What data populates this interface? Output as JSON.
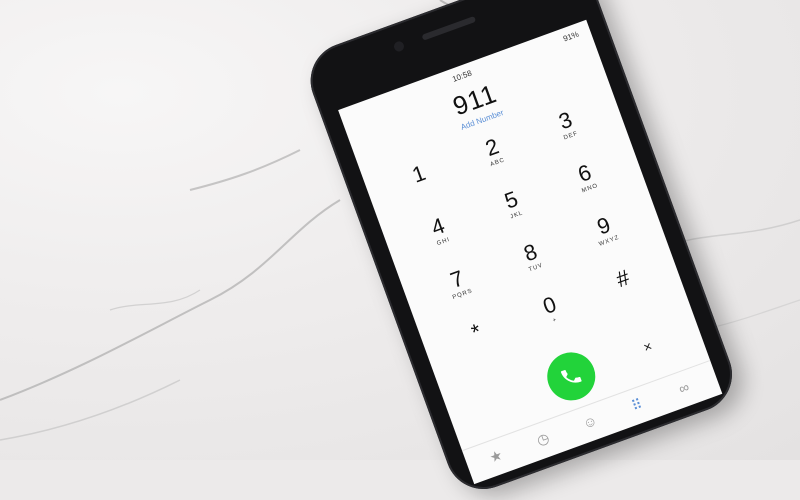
{
  "status_bar": {
    "time": "10:58",
    "battery": "91%"
  },
  "dialer": {
    "number": "911",
    "add_number_label": "Add Number"
  },
  "keypad": [
    {
      "digit": "1",
      "letters": ""
    },
    {
      "digit": "2",
      "letters": "ABC"
    },
    {
      "digit": "3",
      "letters": "DEF"
    },
    {
      "digit": "4",
      "letters": "GHI"
    },
    {
      "digit": "5",
      "letters": "JKL"
    },
    {
      "digit": "6",
      "letters": "MNO"
    },
    {
      "digit": "7",
      "letters": "PQRS"
    },
    {
      "digit": "8",
      "letters": "TUV"
    },
    {
      "digit": "9",
      "letters": "WXYZ"
    },
    {
      "digit": "*",
      "letters": ""
    },
    {
      "digit": "0",
      "letters": "+"
    },
    {
      "digit": "#",
      "letters": ""
    }
  ],
  "actions": {
    "delete_symbol": "×"
  },
  "tabbar": {
    "icons": [
      "favorites-icon",
      "recents-icon",
      "contacts-icon",
      "keypad-icon",
      "voicemail-icon"
    ]
  },
  "colors": {
    "call_button": "#22d33a",
    "phone_body": "#121214",
    "screen": "#fbfbfb",
    "link": "#5b8fd6"
  }
}
